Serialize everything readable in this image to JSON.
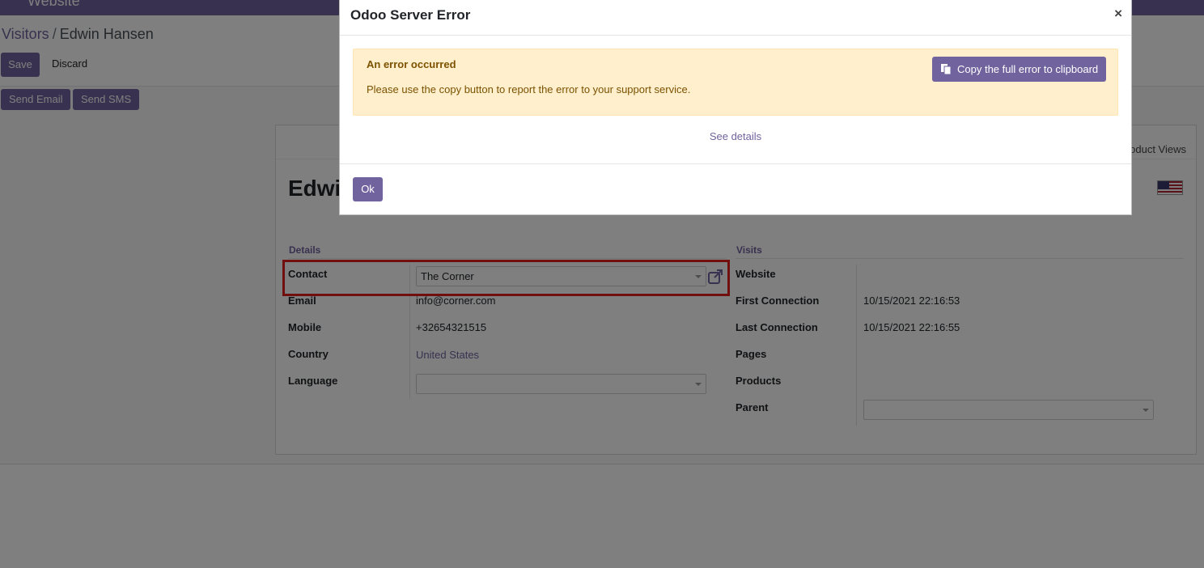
{
  "navbar": {
    "app_name": "Website"
  },
  "breadcrumb": {
    "parent": "Visitors",
    "separator": "/",
    "current": "Edwin Hansen"
  },
  "control_panel": {
    "save_label": "Save",
    "discard_label": "Discard"
  },
  "statusbar": {
    "send_email_label": "Send Email",
    "send_sms_label": "Send SMS"
  },
  "button_box": {
    "stat_label": "oduct Views"
  },
  "form": {
    "title": "Edwi",
    "details": {
      "heading": "Details",
      "contact_label": "Contact",
      "contact_value": "The Corner",
      "email_label": "Email",
      "email_value": "info@corner.com",
      "mobile_label": "Mobile",
      "mobile_value": "+32654321515",
      "country_label": "Country",
      "country_value": "United States",
      "language_label": "Language",
      "language_value": ""
    },
    "visits": {
      "heading": "Visits",
      "website_label": "Website",
      "website_value": "",
      "first_connection_label": "First Connection",
      "first_connection_value": "10/15/2021 22:16:53",
      "last_connection_label": "Last Connection",
      "last_connection_value": "10/15/2021 22:16:55",
      "pages_label": "Pages",
      "products_label": "Products",
      "parent_label": "Parent",
      "parent_value": ""
    }
  },
  "dialog": {
    "title": "Odoo Server Error",
    "close_glyph": "×",
    "alert_title": "An error occurred",
    "alert_text": "Please use the copy button to report the error to your support service.",
    "copy_label": "Copy the full error to clipboard",
    "see_details_label": "See details",
    "ok_label": "Ok"
  },
  "colors": {
    "brand": "#71639e",
    "alert_bg": "#ffefcd",
    "alert_text": "#7c5200",
    "highlight": "#e21c1c"
  }
}
